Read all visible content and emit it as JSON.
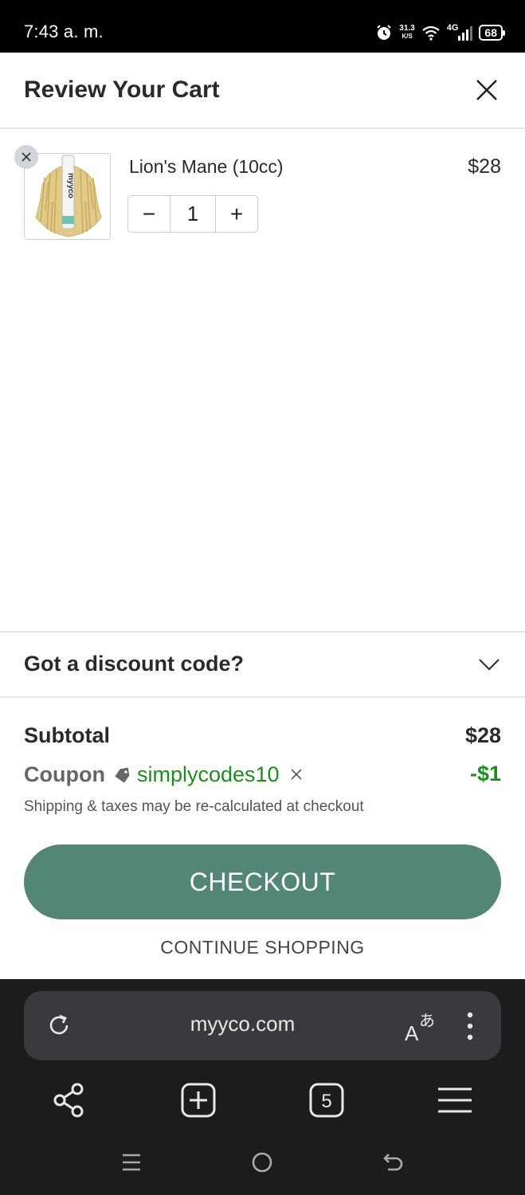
{
  "status_bar": {
    "time": "7:43 a. m.",
    "speed_value": "31.3",
    "speed_unit": "K/S",
    "network": "4G",
    "battery": "68"
  },
  "cart": {
    "title": "Review Your Cart",
    "items": [
      {
        "name": "Lion's Mane (10cc)",
        "price": "$28",
        "quantity": "1",
        "minus_label": "−",
        "plus_label": "+",
        "thumb_brand": "myyco"
      }
    ]
  },
  "discount": {
    "label": "Got a discount code?"
  },
  "totals": {
    "subtotal_label": "Subtotal",
    "subtotal_value": "$28",
    "coupon_label": "Coupon",
    "coupon_code": "simplycodes10",
    "coupon_value": "-$1",
    "shipping_note": "Shipping & taxes may be re-calculated at checkout"
  },
  "actions": {
    "checkout_label": "CHECKOUT",
    "continue_label": "CONTINUE SHOPPING"
  },
  "browser": {
    "url": "myyco.com",
    "tab_count": "5"
  },
  "colors": {
    "checkout_button": "#548677",
    "coupon_green": "#1e8c1e",
    "browser_bg": "#1c1c1e"
  }
}
